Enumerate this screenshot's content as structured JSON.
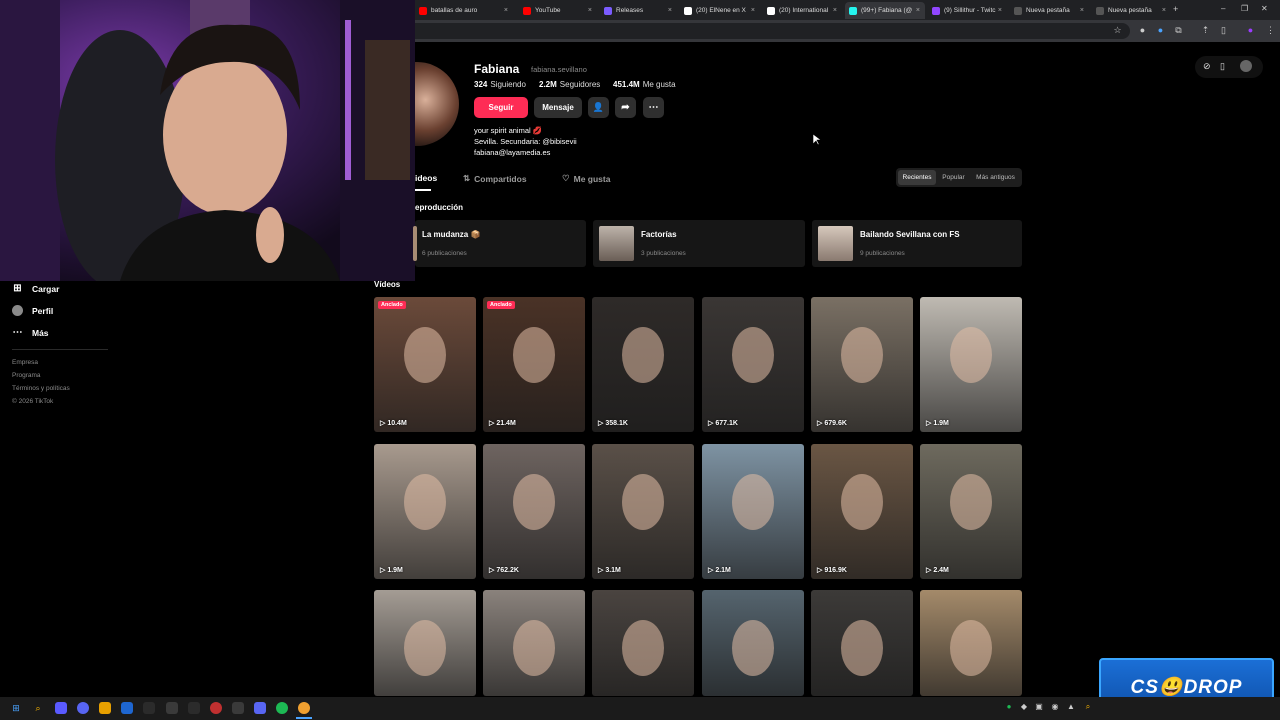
{
  "browser": {
    "tabs": [
      {
        "title": "batallas de auro",
        "color": "#ff0000"
      },
      {
        "title": "YouTube",
        "color": "#ff0000"
      },
      {
        "title": "Releases",
        "color": "#7b5cff"
      },
      {
        "title": "(20) ElNene en X",
        "color": "#ffffff"
      },
      {
        "title": "(20) International",
        "color": "#ffffff"
      },
      {
        "title": "(99+) Fabiana (@",
        "color": "#25f4ee"
      },
      {
        "title": "(9) Sillithur - Twitc",
        "color": "#9146ff"
      },
      {
        "title": "Nueva pestaña",
        "color": "#555555"
      },
      {
        "title": "Nueva pestaña",
        "color": "#555555"
      }
    ],
    "new_tab": "+",
    "window": {
      "minimize": "–",
      "maximize": "❐",
      "close": "✕"
    }
  },
  "sidebar": {
    "items": [
      {
        "label": "Cargar",
        "icon": "plus-box-icon"
      },
      {
        "label": "Perfil",
        "icon": "avatar-icon"
      },
      {
        "label": "Más",
        "icon": "ellipsis-icon"
      }
    ],
    "footer": [
      "Empresa",
      "Programa",
      "Términos y políticas",
      "© 2026 TikTok"
    ]
  },
  "profile": {
    "name": "Fabiana",
    "handle": "fabiana.sevillano",
    "stats": [
      {
        "value": "324",
        "label": "Siguiendo"
      },
      {
        "value": "2.2M",
        "label": "Seguidores"
      },
      {
        "value": "451.4M",
        "label": "Me gusta"
      }
    ],
    "follow_label": "Seguir",
    "message_label": "Mensaje",
    "bio": [
      "your spirit animal 💋",
      "Sevilla. Secundaria: @bibisevii",
      "fabiana@layamedia.es"
    ]
  },
  "content_tabs": [
    {
      "label": "ideos",
      "icon": ""
    },
    {
      "label": "Compartidos",
      "icon": "⇅"
    },
    {
      "label": "Me gusta",
      "icon": "♡"
    }
  ],
  "sort_options": [
    "Recientes",
    "Popular",
    "Más antiguos"
  ],
  "playlists_heading": "eproducción",
  "playlists": [
    {
      "title": "La mudanza 📦",
      "count": "6 publicaciones"
    },
    {
      "title": "Factorías",
      "count": "3 publicaciones"
    },
    {
      "title": "Bailando Sevillana con FS",
      "count": "9 publicaciones"
    }
  ],
  "videos_heading": "Vídeos",
  "pinned_label": "Anclado",
  "videos": [
    {
      "views": "10.4M",
      "pinned": true,
      "color": "#6b4a3a"
    },
    {
      "views": "21.4M",
      "pinned": true,
      "color": "#4a3226"
    },
    {
      "views": "358.1K",
      "pinned": false,
      "color": "#2e2a28"
    },
    {
      "views": "677.1K",
      "pinned": false,
      "color": "#3a3634"
    },
    {
      "views": "679.6K",
      "pinned": false,
      "color": "#7a7064"
    },
    {
      "views": "1.9M",
      "pinned": false,
      "color": "#bfbab2"
    },
    {
      "views": "1.9M",
      "pinned": false,
      "color": "#a89a8e"
    },
    {
      "views": "762.2K",
      "pinned": false,
      "color": "#6e6460"
    },
    {
      "views": "3.1M",
      "pinned": false,
      "color": "#5a5048"
    },
    {
      "views": "2.1M",
      "pinned": false,
      "color": "#7e93a3"
    },
    {
      "views": "916.9K",
      "pinned": false,
      "color": "#6a5644"
    },
    {
      "views": "2.4M",
      "pinned": false,
      "color": "#6e6a5e"
    },
    {
      "views": "",
      "pinned": false,
      "color": "#a49c94"
    },
    {
      "views": "",
      "pinned": false,
      "color": "#8a827c"
    },
    {
      "views": "",
      "pinned": false,
      "color": "#4a4440"
    },
    {
      "views": "",
      "pinned": false,
      "color": "#55646e"
    },
    {
      "views": "",
      "pinned": false,
      "color": "#3c3a38"
    },
    {
      "views": "",
      "pinned": false,
      "color": "#a48a6a"
    }
  ],
  "overlay_badge": "CS😃DROP",
  "colors": {
    "accent": "#fe2c55",
    "panel": "#161616",
    "muted": "#8a8a8a"
  }
}
